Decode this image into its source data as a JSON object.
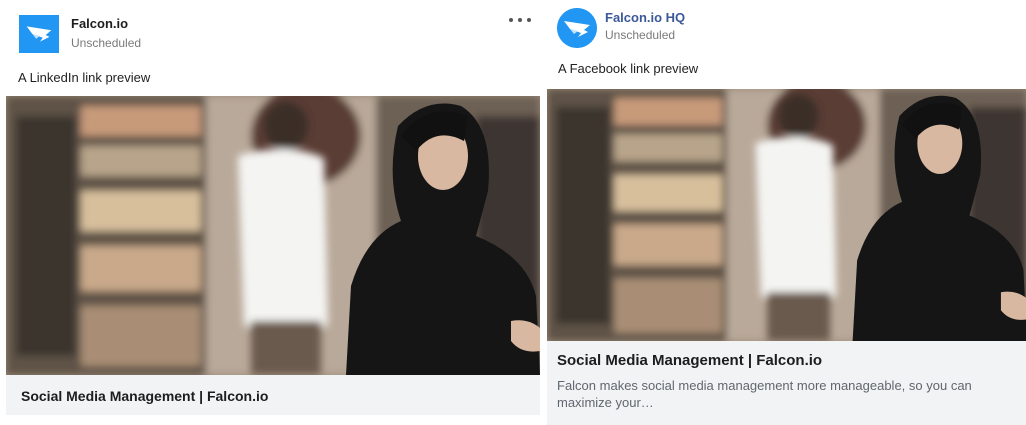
{
  "linkedin": {
    "account_name": "Falcon.io",
    "status": "Unscheduled",
    "caption": "A LinkedIn link preview",
    "link_title": "Social Media Management | Falcon.io",
    "more_icon": "more-horizontal-icon"
  },
  "facebook": {
    "account_name": "Falcon.io HQ",
    "status": "Unscheduled",
    "caption": "A Facebook link preview",
    "link_title": "Social Media Management | Falcon.io",
    "link_description": "Falcon makes social media management more manageable, so you can maximize your…"
  },
  "colors": {
    "brand_blue": "#2196f3",
    "facebook_name": "#3b5998",
    "preview_bar": "#f1f3f5"
  }
}
